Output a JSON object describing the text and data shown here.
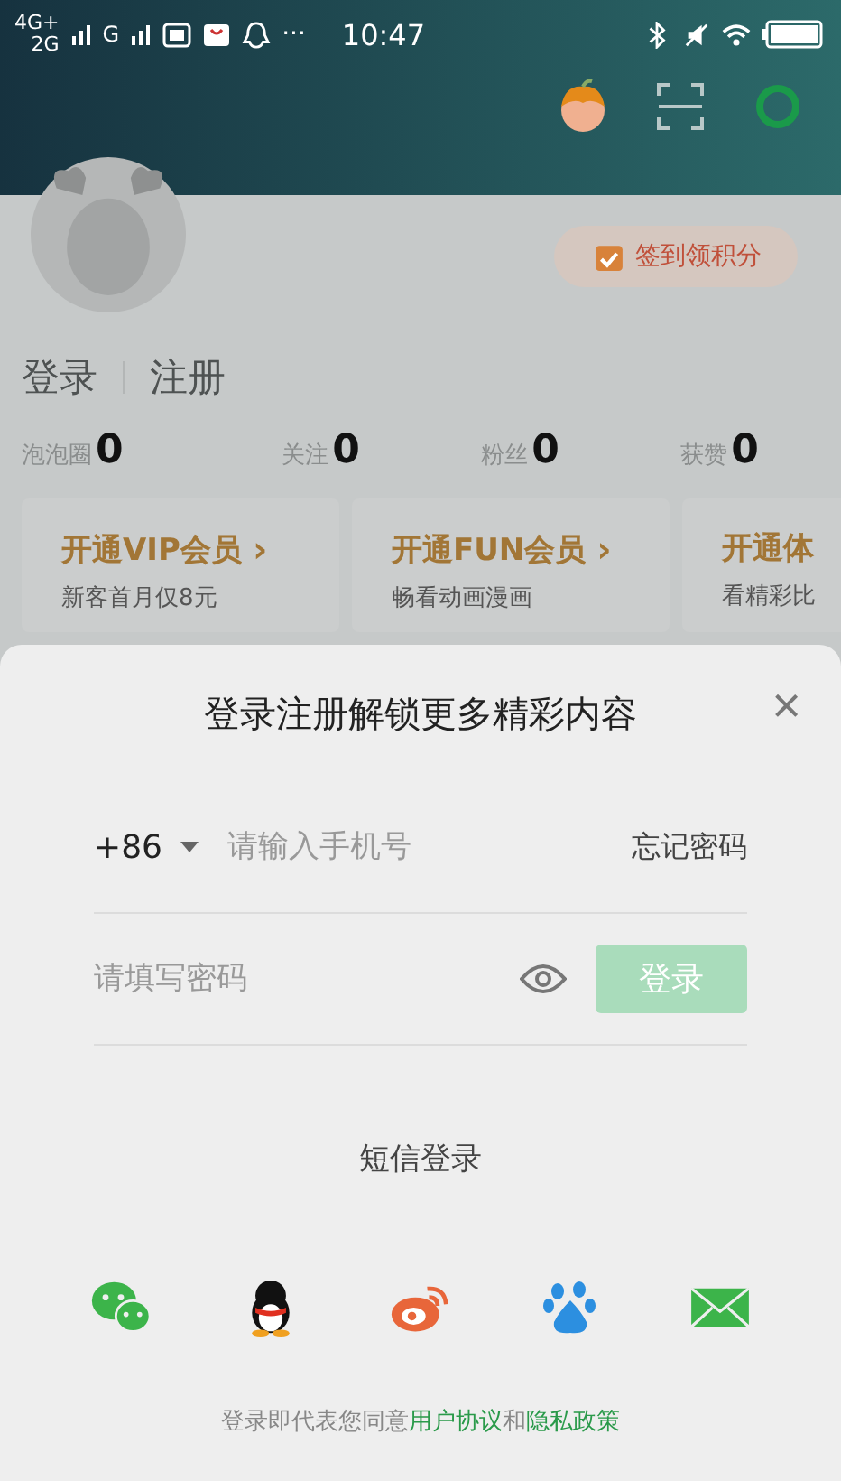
{
  "status_bar": {
    "network_1": "4G+",
    "network_2": "2G",
    "network_3": "G",
    "more": "···",
    "time": "10:47"
  },
  "profile": {
    "checkin": "签到领积分",
    "login": "登录",
    "register": "注册",
    "stats": [
      {
        "label": "泡泡圈",
        "value": "0"
      },
      {
        "label": "关注",
        "value": "0"
      },
      {
        "label": "粉丝",
        "value": "0"
      },
      {
        "label": "获赞",
        "value": "0"
      }
    ]
  },
  "cards": [
    {
      "title": "开通VIP会员",
      "arrow": "›",
      "subtitle": "新客首月仅8元"
    },
    {
      "title": "开通FUN会员",
      "arrow": "›",
      "subtitle": "畅看动画漫画"
    },
    {
      "title": "开通体",
      "subtitle": "看精彩比"
    }
  ],
  "login_sheet": {
    "title": "登录注册解锁更多精彩内容",
    "close": "×",
    "country_code": "+86",
    "phone": {
      "placeholder": "请输入手机号"
    },
    "forgot": "忘记密码",
    "password": {
      "placeholder": "请填写密码"
    },
    "login_button": {
      "label": "登录",
      "disabled": true
    },
    "sms_login": "短信登录",
    "social": [
      {
        "kind": "wechat"
      },
      {
        "kind": "qq"
      },
      {
        "kind": "weibo"
      },
      {
        "kind": "baidu"
      },
      {
        "kind": "mail"
      }
    ],
    "agreement": {
      "prefix": "登录即代表您同意",
      "link_1": "用户协议",
      "joiner": "和",
      "link_2": "隐私政策"
    }
  }
}
